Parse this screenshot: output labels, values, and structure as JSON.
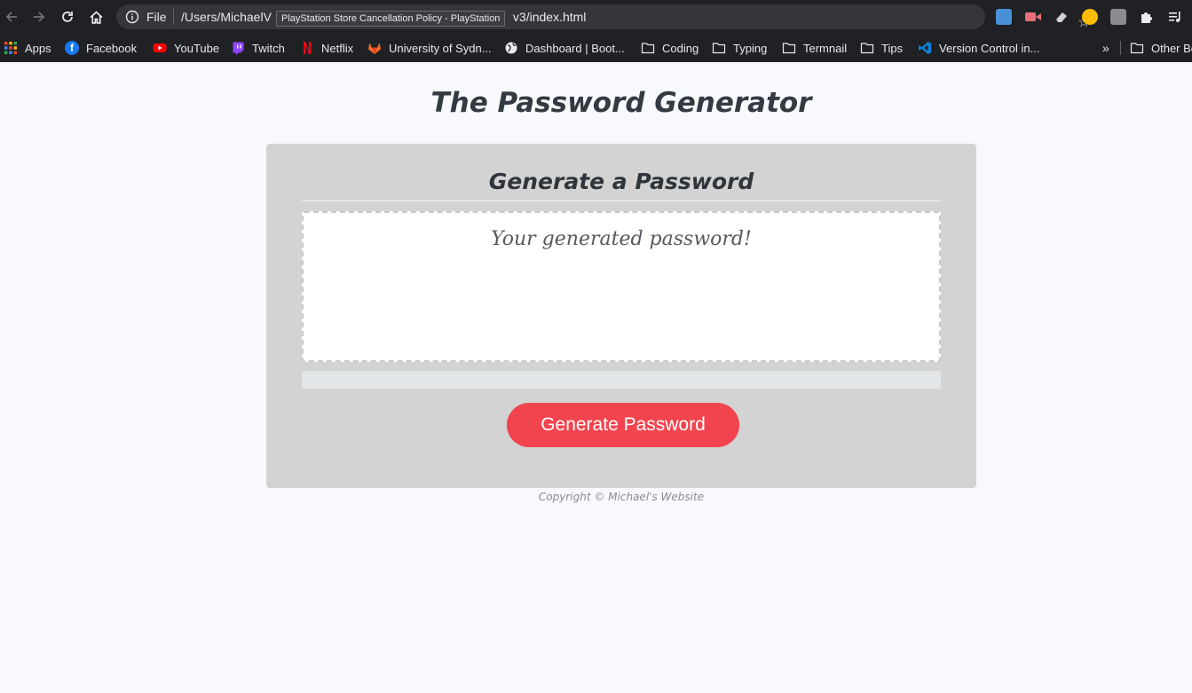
{
  "browser": {
    "omnibox_scheme": "File",
    "url_visible": "/Users/MichaelV",
    "url_tail": "v3/index.html",
    "tooltip": "PlayStation Store Cancellation Policy - PlayStation",
    "bookmarks": [
      {
        "label": "Apps",
        "icon": "apps-grid-icon"
      },
      {
        "label": "Facebook",
        "icon": "facebook-icon"
      },
      {
        "label": "YouTube",
        "icon": "youtube-icon"
      },
      {
        "label": "Twitch",
        "icon": "twitch-icon"
      },
      {
        "label": "Netflix",
        "icon": "netflix-icon"
      },
      {
        "label": "University of Sydn...",
        "icon": "gitlab-icon"
      },
      {
        "label": "Dashboard | Boot...",
        "icon": "globe-icon"
      },
      {
        "label": "Coding",
        "icon": "folder-icon"
      },
      {
        "label": "Typing",
        "icon": "folder-icon"
      },
      {
        "label": "Termnail",
        "icon": "folder-icon"
      },
      {
        "label": "Tips",
        "icon": "folder-icon"
      },
      {
        "label": "Version Control in...",
        "icon": "vscode-icon"
      }
    ],
    "overflow_label": "»",
    "other_bookmarks": "Other Bo"
  },
  "page": {
    "title": "The Password Generator",
    "card_title": "Generate a Password",
    "password_placeholder": "Your generated password!",
    "button_label": "Generate Password",
    "footer": "Copyright © Michael's Website"
  },
  "colors": {
    "button": "#f2444e",
    "card": "#d3d3d3",
    "page_bg": "#f8f9fd"
  }
}
